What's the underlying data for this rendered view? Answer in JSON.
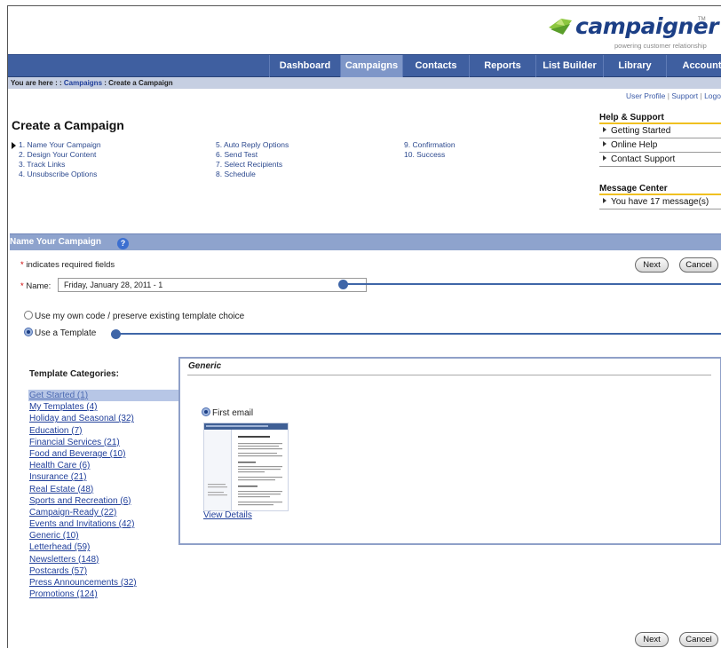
{
  "brand": {
    "logo_text": "campaigner",
    "tm": "TM",
    "tagline": "powering customer relationship"
  },
  "nav": {
    "items": [
      "Dashboard",
      "Campaigns",
      "Contacts",
      "Reports",
      "List Builder",
      "Library",
      "Account"
    ],
    "active": "Campaigns"
  },
  "breadcrumb": {
    "prefix": "You are here : :",
    "link": "Campaigns",
    "sep": ":",
    "current": "Create a Campaign"
  },
  "util": {
    "user_profile": "User Profile",
    "support": "Support",
    "logout": "Logo"
  },
  "page_title": "Create a Campaign",
  "steps": [
    "1. Name Your Campaign",
    "2. Design Your Content",
    "3. Track Links",
    "4. Unsubscribe Options",
    "5. Auto Reply Options",
    "6. Send Test",
    "7. Select Recipients",
    "8. Schedule",
    "9. Confirmation",
    "10. Success"
  ],
  "help": {
    "title": "Help & Support",
    "links": [
      "Getting Started",
      "Online Help",
      "Contact Support"
    ]
  },
  "messages": {
    "title": "Message Center",
    "text": "You have 17 message(s)"
  },
  "section": {
    "title": "Name Your Campaign",
    "help_icon": "?"
  },
  "form": {
    "required_note": "indicates required fields",
    "name_label": "Name:",
    "name_value": "Friday, January 28, 2011 - 1",
    "next_label": "Next",
    "cancel_label": "Cancel",
    "radio_own_code": "Use my own code / preserve existing template choice",
    "radio_template": "Use a Template",
    "selected_option": "Use a Template"
  },
  "templates": {
    "heading": "Template Categories:",
    "categories": [
      "Get Started (1)",
      "My Templates (4)",
      "Holiday and Seasonal (32)",
      "Education (7)",
      "Financial Services (21)",
      "Food and Beverage (10)",
      "Health Care (6)",
      "Insurance (21)",
      "Real Estate (48)",
      "Sports and Recreation (6)",
      "Campaign-Ready (22)",
      "Events and Invitations (42)",
      "Generic (10)",
      "Letterhead (59)",
      "Newsletters (148)",
      "Postcards (57)",
      "Press Announcements (32)",
      "Promotions (124)"
    ],
    "selected_category": "Get Started (1)",
    "panel_title": "Generic",
    "template_name": "First email",
    "view_details": "View Details"
  },
  "colors": {
    "nav_bg": "#3f5fa0",
    "nav_active": "#7e96c8",
    "section_bar": "#8ea3cd",
    "link": "#1f3e9a",
    "accent_yellow": "#f0c020",
    "brand_blue": "#1c3f86",
    "brand_green": "#8cc63f"
  }
}
